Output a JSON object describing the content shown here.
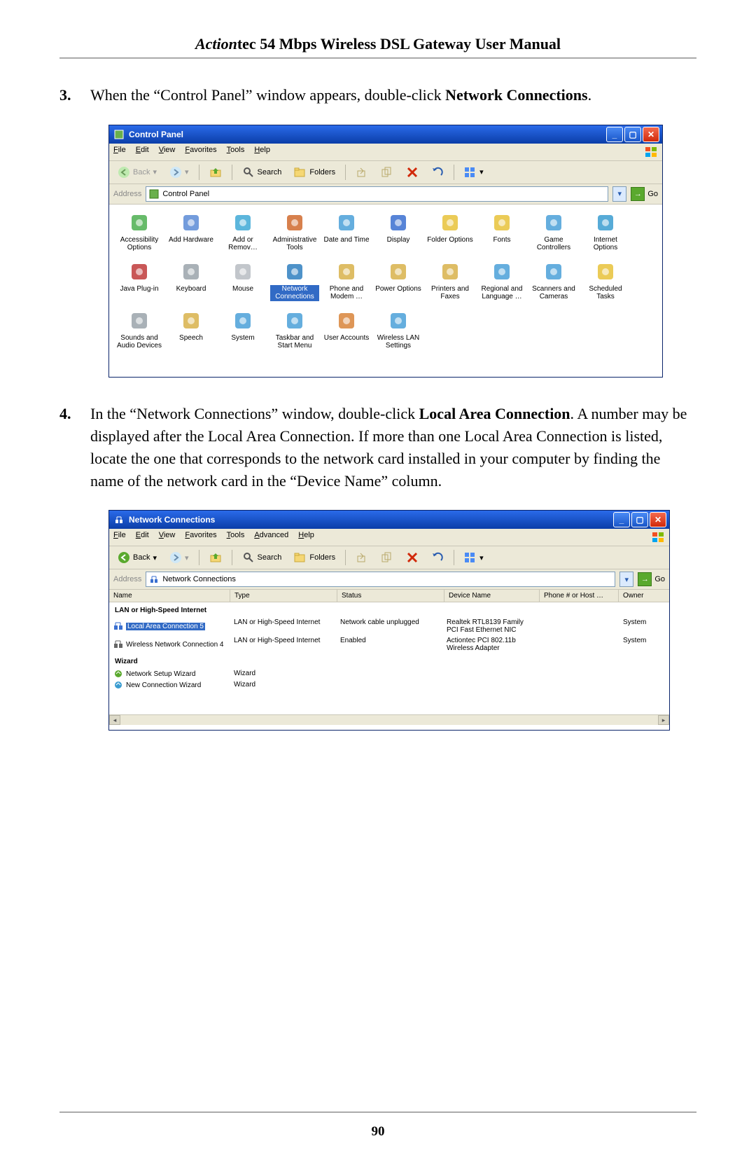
{
  "header": {
    "brand": "Action",
    "rest": "tec 54 Mbps Wireless DSL Gateway User Manual"
  },
  "page_number": "90",
  "steps": {
    "s3": {
      "num": "3.",
      "prefix": "When the “Control Panel” window appears, double-click ",
      "bold": "Network Connections",
      "suffix": "."
    },
    "s4": {
      "num": "4.",
      "prefix": "In the “Network Connections” window, double-click ",
      "bold": "Local Area Connection",
      "suffix": ". A number may be displayed after the Local Area Connection. If more than one Local Area Connection is listed, locate the one that corresponds to the network card installed in your computer by finding the name of the network card in the “Device Name” column."
    }
  },
  "win_common": {
    "menus_cp": [
      "File",
      "Edit",
      "View",
      "Favorites",
      "Tools",
      "Help"
    ],
    "menus_nc": [
      "File",
      "Edit",
      "View",
      "Favorites",
      "Tools",
      "Advanced",
      "Help"
    ],
    "back": "Back",
    "search": "Search",
    "folders": "Folders",
    "address_lbl": "Address",
    "go": "Go"
  },
  "control_panel": {
    "title": "Control Panel",
    "address": "Control Panel",
    "items": [
      {
        "label": "Accessibility Options",
        "c": "#4caf50"
      },
      {
        "label": "Add Hardware",
        "c": "#5b8bd6"
      },
      {
        "label": "Add or Remov…",
        "c": "#3fa9d6"
      },
      {
        "label": "Administrative Tools",
        "c": "#d06a2e"
      },
      {
        "label": "Date and Time",
        "c": "#4aa0d8"
      },
      {
        "label": "Display",
        "c": "#3a6fd0"
      },
      {
        "label": "Folder Options",
        "c": "#e8c23a"
      },
      {
        "label": "Fonts",
        "c": "#e8c23a"
      },
      {
        "label": "Game Controllers",
        "c": "#4aa0d8"
      },
      {
        "label": "Internet Options",
        "c": "#3a9cd0"
      },
      {
        "label": "Java Plug-in",
        "c": "#c03a3a"
      },
      {
        "label": "Keyboard",
        "c": "#9aa3aa"
      },
      {
        "label": "Mouse",
        "c": "#b7bcc2"
      },
      {
        "label": "Network Connections",
        "c": "#2f7fbf",
        "sel": true
      },
      {
        "label": "Phone and Modem …",
        "c": "#d8b24a"
      },
      {
        "label": "Power Options",
        "c": "#d8b24a"
      },
      {
        "label": "Printers and Faxes",
        "c": "#d8b24a"
      },
      {
        "label": "Regional and Language …",
        "c": "#4aa0d8"
      },
      {
        "label": "Scanners and Cameras",
        "c": "#4aa0d8"
      },
      {
        "label": "Scheduled Tasks",
        "c": "#e8c23a"
      },
      {
        "label": "Sounds and Audio Devices",
        "c": "#9aa3aa"
      },
      {
        "label": "Speech",
        "c": "#d8b24a"
      },
      {
        "label": "System",
        "c": "#4aa0d8"
      },
      {
        "label": "Taskbar and Start Menu",
        "c": "#4aa0d8"
      },
      {
        "label": "User Accounts",
        "c": "#d8843a"
      },
      {
        "label": "Wireless LAN Settings",
        "c": "#4aa0d8"
      }
    ]
  },
  "net_conn": {
    "title": "Network Connections",
    "address": "Network Connections",
    "cols": {
      "name": "Name",
      "type": "Type",
      "status": "Status",
      "dev": "Device Name",
      "phone": "Phone # or Host …",
      "owner": "Owner"
    },
    "group1": "LAN or High-Speed Internet",
    "rows": [
      {
        "name": "Local Area Connection 5",
        "type": "LAN or High-Speed Internet",
        "status": "Network cable unplugged",
        "dev": "Realtek RTL8139 Family PCI Fast Ethernet NIC",
        "owner": "System",
        "sel": true,
        "ic": "#3a6fd0"
      },
      {
        "name": "Wireless Network Connection 4",
        "type": "LAN or High-Speed Internet",
        "status": "Enabled",
        "dev": "Actiontec PCI 802.11b Wireless Adapter",
        "owner": "System",
        "ic": "#666"
      }
    ],
    "group2": "Wizard",
    "wiz": [
      {
        "name": "Network Setup Wizard",
        "type": "Wizard",
        "ic": "#5aa92e"
      },
      {
        "name": "New Connection Wizard",
        "type": "Wizard",
        "ic": "#3a9cd0"
      }
    ]
  }
}
